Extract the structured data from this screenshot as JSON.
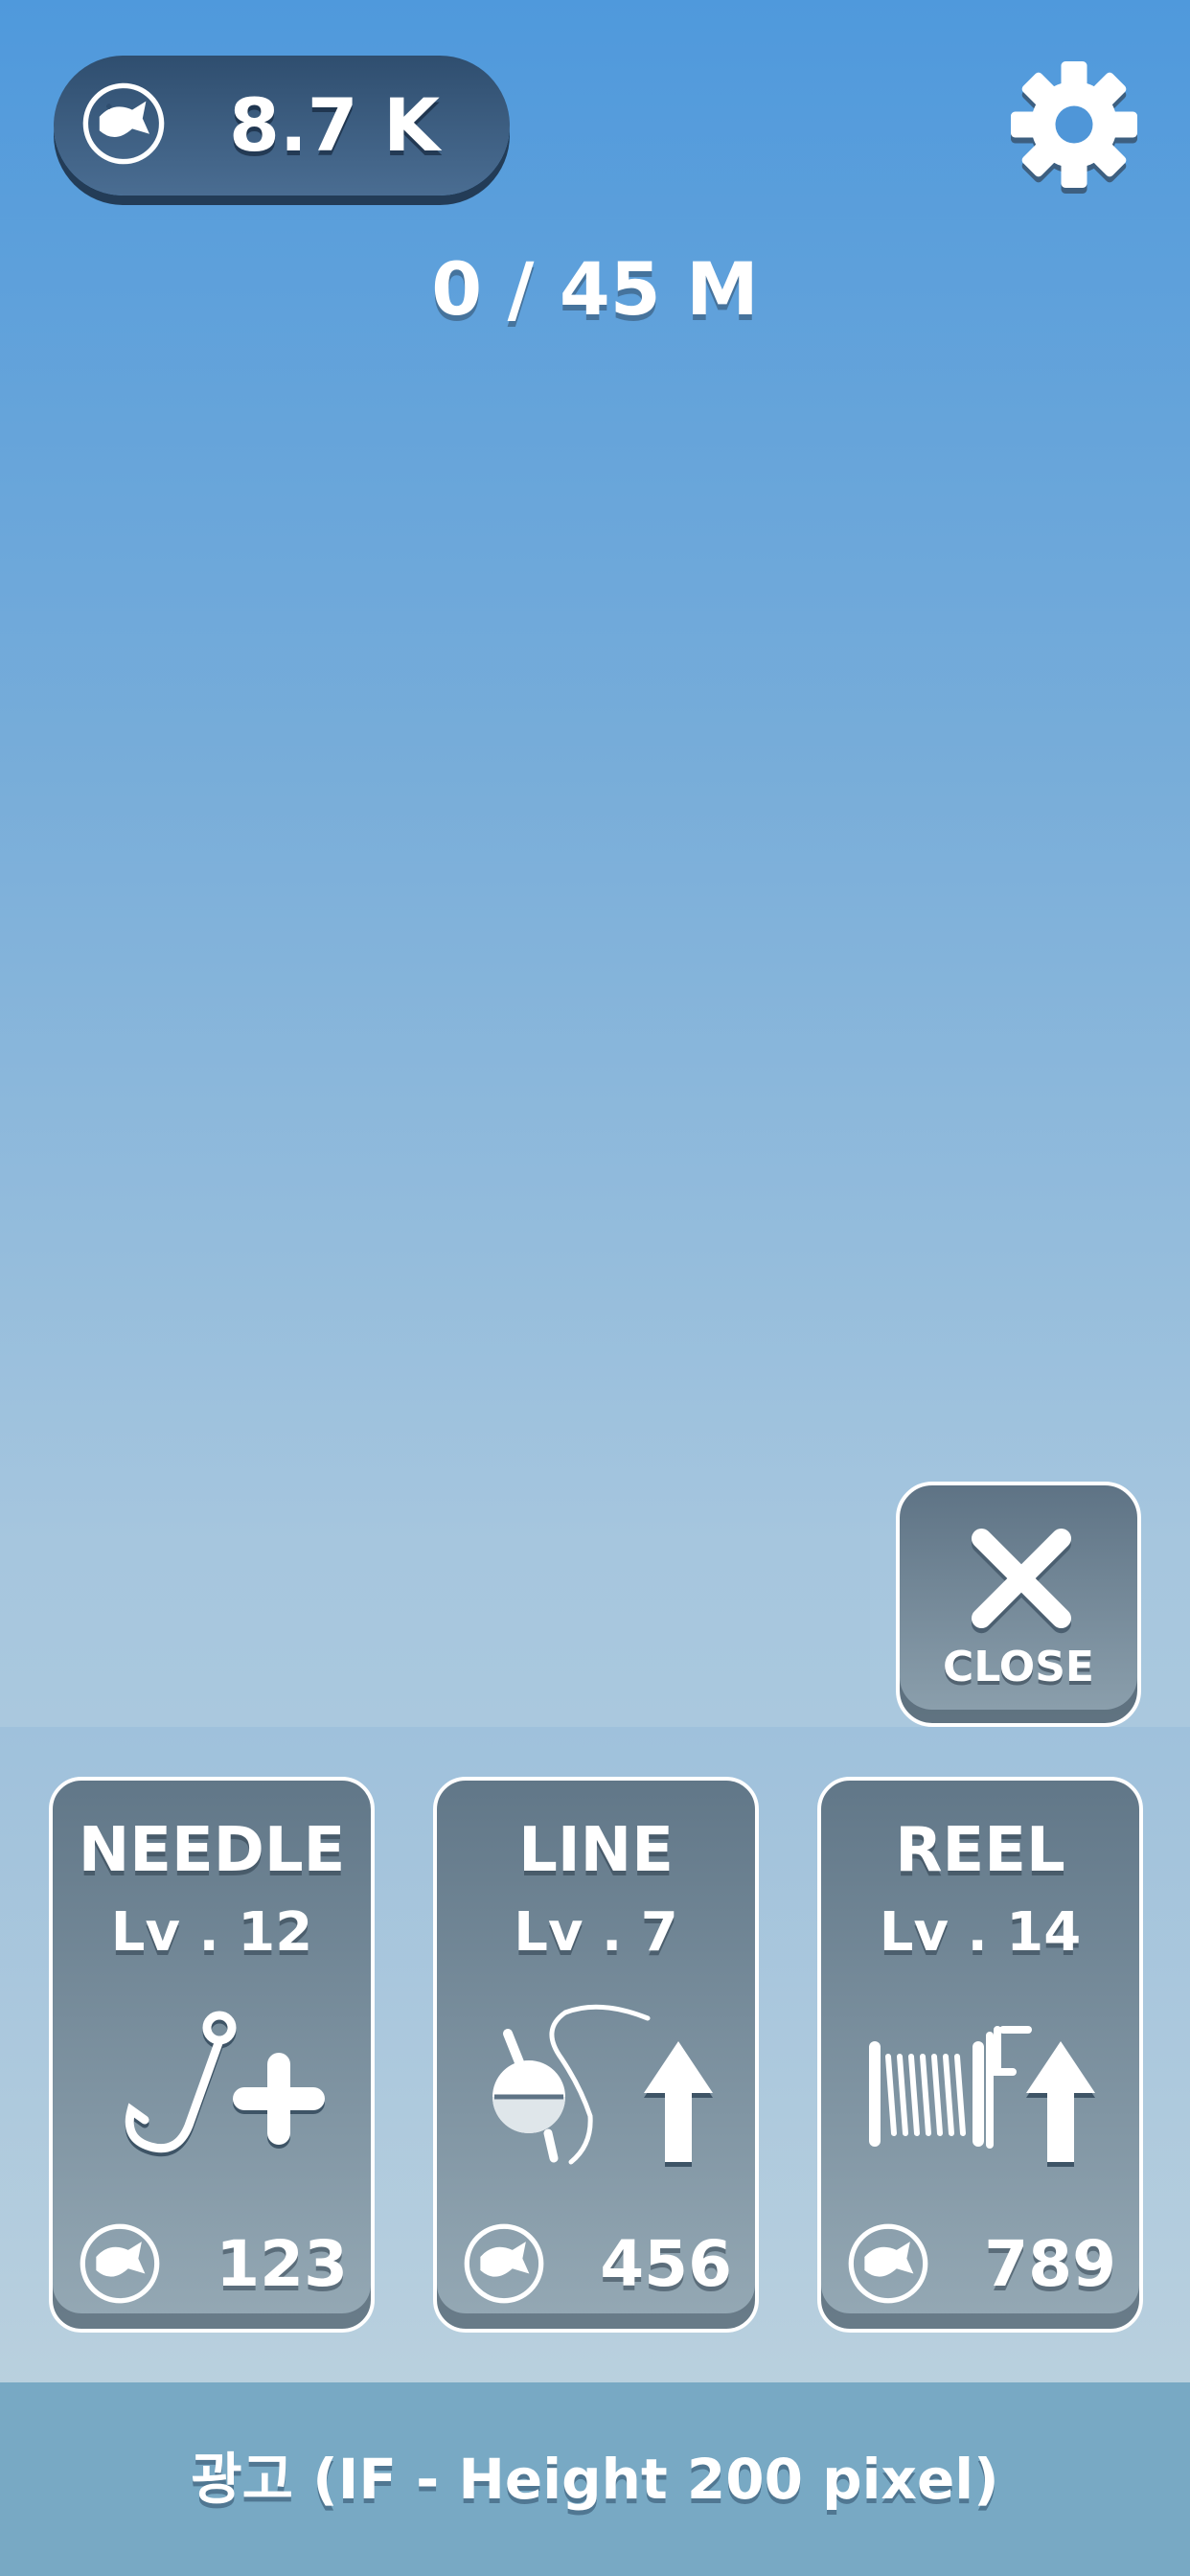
{
  "currency": {
    "value": "8.7 K",
    "icon": "fish-coin-icon"
  },
  "settings": {
    "icon": "gear-icon"
  },
  "distance": {
    "text": "0 / 45 M"
  },
  "close_button": {
    "label": "CLOSE",
    "icon": "close-x-icon"
  },
  "upgrades": [
    {
      "title": "NEEDLE",
      "level": "Lv . 12",
      "cost": "123",
      "icon": "hook-plus-icon"
    },
    {
      "title": "LINE",
      "level": "Lv . 7",
      "cost": "456",
      "icon": "float-line-arrow-up-icon"
    },
    {
      "title": "REEL",
      "level": "Lv . 14",
      "cost": "789",
      "icon": "reel-arrow-up-icon"
    }
  ],
  "ad_banner": {
    "text": "광고 (IF - Height 200 pixel)"
  },
  "colors": {
    "sky_top": "#4f99dc",
    "sky_bottom": "#bcd3df",
    "pill_dark": "#2f4e6f",
    "card_top": "#617788",
    "card_bottom": "#95a9b5",
    "ad_bg": "#78a9c4"
  }
}
